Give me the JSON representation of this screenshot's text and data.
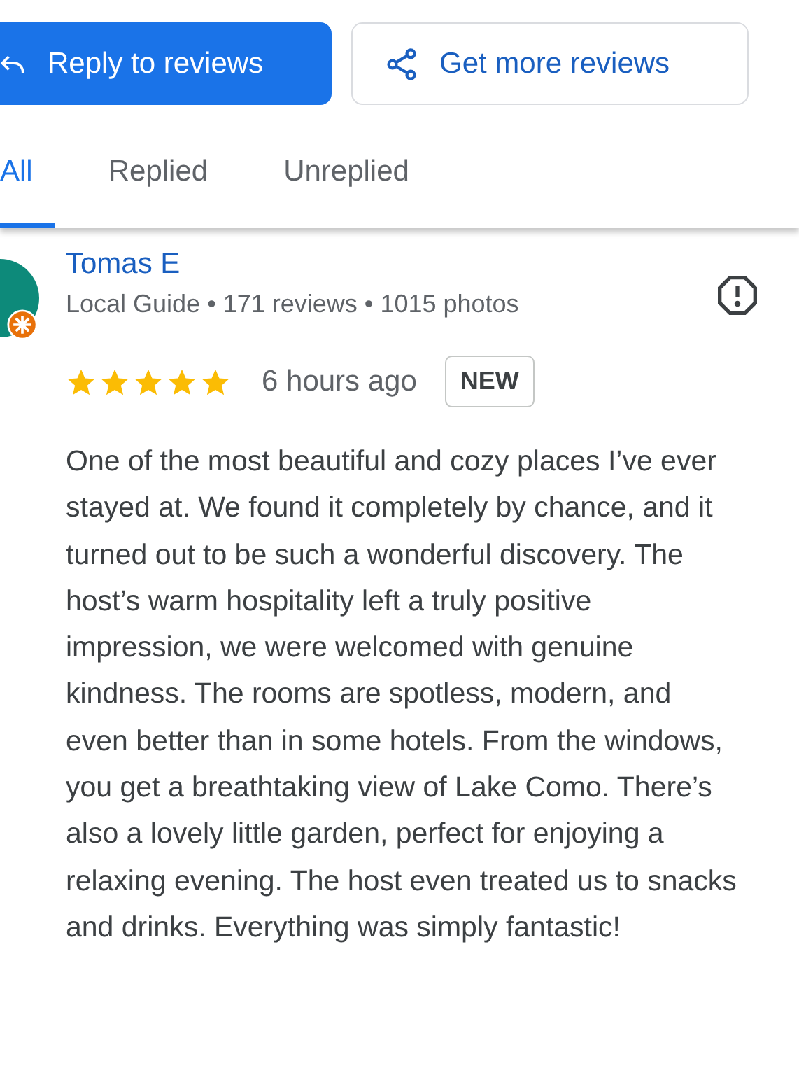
{
  "actions": [
    {
      "kind": "primary",
      "label": "Reply to reviews"
    },
    {
      "kind": "secondary",
      "label": "Get more reviews"
    }
  ],
  "tabs": [
    {
      "label": "All",
      "selected": true
    },
    {
      "label": "Replied",
      "selected": false
    },
    {
      "label": "Unreplied",
      "selected": false
    }
  ],
  "review": {
    "author": "Tomas E",
    "meta": "Local Guide • 171 reviews • 1015 photos",
    "local_guide": true,
    "stars": 5,
    "time": "6 hours ago",
    "badge": "NEW",
    "text": "One of the most beautiful and cozy places I’ve ever stayed at. We found it completely by chance, and it turned out to be such a wonderful discovery. The host’s warm hospitality left a truly positive impression, we were welcomed with genuine kindness. The rooms are spotless, modern, and even better than in some hotels. From the windows, you get a breathtaking view of Lake Como. There’s also a lovely little garden, perfect for enjoying a relaxing evening. The host even treated us to snacks and drinks. Everything was simply fantastic!"
  }
}
